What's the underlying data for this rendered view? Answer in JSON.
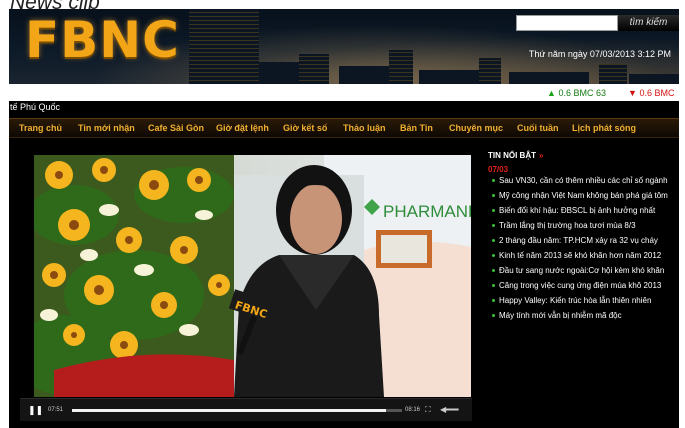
{
  "page_heading": "News clip",
  "header": {
    "logo": "FBNC",
    "search": {
      "value": "",
      "placeholder": "",
      "button_label": "tìm kiếm"
    },
    "datetime": "Thứ năm ngày 07/03/2013 3:12 PM"
  },
  "ticker": [
    {
      "direction": "up",
      "arrow": "▲",
      "value": "0.6",
      "label": "BMC 63"
    },
    {
      "direction": "down",
      "arrow": "▼",
      "value": "0.6",
      "label": "BMC"
    }
  ],
  "breadcrumb": "tế Phú Quốc",
  "nav": [
    "Trang chủ",
    "Tin mới nhận",
    "Cafe Sài Gòn",
    "Giờ đặt lệnh",
    "Giờ kết số",
    "Thảo luận",
    "Bản Tin",
    "Chuyên mục",
    "Cuối tuần",
    "Lịch phát sóng"
  ],
  "video": {
    "sponsor_text": "PHARMANE",
    "mic_label": "FBNC",
    "elapsed": "07:51",
    "duration": "08:16",
    "progress": 0.95
  },
  "news": {
    "title": "TIN NỔI BẬT",
    "title_arrow": "»",
    "date": "07/03",
    "items": [
      "Sau VN30, cần có thêm nhiều các chỉ số ngành",
      "Mỹ công nhận Việt Nam không bán phá giá tôm",
      "Biến đổi khí hậu: ĐBSCL bị ảnh hưởng nhất",
      "Trầm lắng thị trường hoa tươi mùa 8/3",
      "2 tháng đầu năm: TP.HCM xảy ra 32 vụ cháy",
      "Kinh tế năm 2013 sẽ khó khăn hơn năm 2012",
      "Đầu tư sang nước ngoài:Cơ hội kèm khó khăn",
      "Căng trong việc cung ứng điện mùa khô 2013",
      "Happy Valley: Kiến trúc hòa lẫn thiên nhiên",
      "Máy tính mới vẫn bị nhiễm mã độc"
    ]
  },
  "colors": {
    "nav_text": "#f0b030",
    "accent_red": "#e2231a",
    "bullet_green": "#37c137",
    "logo_gold": "#f2a516"
  }
}
